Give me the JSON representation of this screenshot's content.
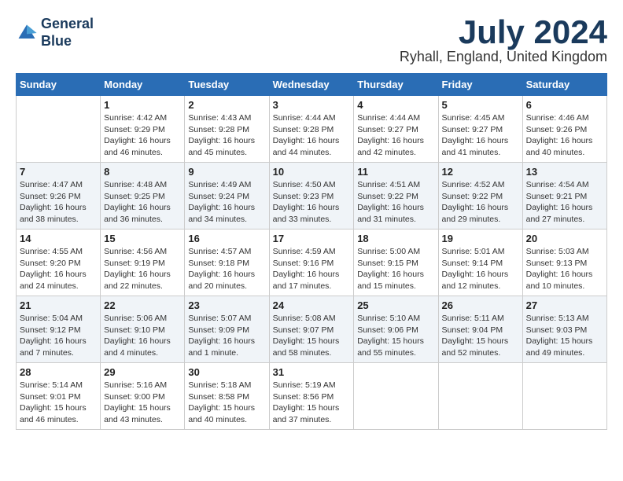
{
  "logo": {
    "line1": "General",
    "line2": "Blue"
  },
  "title": "July 2024",
  "location": "Ryhall, England, United Kingdom",
  "weekdays": [
    "Sunday",
    "Monday",
    "Tuesday",
    "Wednesday",
    "Thursday",
    "Friday",
    "Saturday"
  ],
  "weeks": [
    [
      {
        "day": "",
        "info": ""
      },
      {
        "day": "1",
        "info": "Sunrise: 4:42 AM\nSunset: 9:29 PM\nDaylight: 16 hours\nand 46 minutes."
      },
      {
        "day": "2",
        "info": "Sunrise: 4:43 AM\nSunset: 9:28 PM\nDaylight: 16 hours\nand 45 minutes."
      },
      {
        "day": "3",
        "info": "Sunrise: 4:44 AM\nSunset: 9:28 PM\nDaylight: 16 hours\nand 44 minutes."
      },
      {
        "day": "4",
        "info": "Sunrise: 4:44 AM\nSunset: 9:27 PM\nDaylight: 16 hours\nand 42 minutes."
      },
      {
        "day": "5",
        "info": "Sunrise: 4:45 AM\nSunset: 9:27 PM\nDaylight: 16 hours\nand 41 minutes."
      },
      {
        "day": "6",
        "info": "Sunrise: 4:46 AM\nSunset: 9:26 PM\nDaylight: 16 hours\nand 40 minutes."
      }
    ],
    [
      {
        "day": "7",
        "info": "Sunrise: 4:47 AM\nSunset: 9:26 PM\nDaylight: 16 hours\nand 38 minutes."
      },
      {
        "day": "8",
        "info": "Sunrise: 4:48 AM\nSunset: 9:25 PM\nDaylight: 16 hours\nand 36 minutes."
      },
      {
        "day": "9",
        "info": "Sunrise: 4:49 AM\nSunset: 9:24 PM\nDaylight: 16 hours\nand 34 minutes."
      },
      {
        "day": "10",
        "info": "Sunrise: 4:50 AM\nSunset: 9:23 PM\nDaylight: 16 hours\nand 33 minutes."
      },
      {
        "day": "11",
        "info": "Sunrise: 4:51 AM\nSunset: 9:22 PM\nDaylight: 16 hours\nand 31 minutes."
      },
      {
        "day": "12",
        "info": "Sunrise: 4:52 AM\nSunset: 9:22 PM\nDaylight: 16 hours\nand 29 minutes."
      },
      {
        "day": "13",
        "info": "Sunrise: 4:54 AM\nSunset: 9:21 PM\nDaylight: 16 hours\nand 27 minutes."
      }
    ],
    [
      {
        "day": "14",
        "info": "Sunrise: 4:55 AM\nSunset: 9:20 PM\nDaylight: 16 hours\nand 24 minutes."
      },
      {
        "day": "15",
        "info": "Sunrise: 4:56 AM\nSunset: 9:19 PM\nDaylight: 16 hours\nand 22 minutes."
      },
      {
        "day": "16",
        "info": "Sunrise: 4:57 AM\nSunset: 9:18 PM\nDaylight: 16 hours\nand 20 minutes."
      },
      {
        "day": "17",
        "info": "Sunrise: 4:59 AM\nSunset: 9:16 PM\nDaylight: 16 hours\nand 17 minutes."
      },
      {
        "day": "18",
        "info": "Sunrise: 5:00 AM\nSunset: 9:15 PM\nDaylight: 16 hours\nand 15 minutes."
      },
      {
        "day": "19",
        "info": "Sunrise: 5:01 AM\nSunset: 9:14 PM\nDaylight: 16 hours\nand 12 minutes."
      },
      {
        "day": "20",
        "info": "Sunrise: 5:03 AM\nSunset: 9:13 PM\nDaylight: 16 hours\nand 10 minutes."
      }
    ],
    [
      {
        "day": "21",
        "info": "Sunrise: 5:04 AM\nSunset: 9:12 PM\nDaylight: 16 hours\nand 7 minutes."
      },
      {
        "day": "22",
        "info": "Sunrise: 5:06 AM\nSunset: 9:10 PM\nDaylight: 16 hours\nand 4 minutes."
      },
      {
        "day": "23",
        "info": "Sunrise: 5:07 AM\nSunset: 9:09 PM\nDaylight: 16 hours\nand 1 minute."
      },
      {
        "day": "24",
        "info": "Sunrise: 5:08 AM\nSunset: 9:07 PM\nDaylight: 15 hours\nand 58 minutes."
      },
      {
        "day": "25",
        "info": "Sunrise: 5:10 AM\nSunset: 9:06 PM\nDaylight: 15 hours\nand 55 minutes."
      },
      {
        "day": "26",
        "info": "Sunrise: 5:11 AM\nSunset: 9:04 PM\nDaylight: 15 hours\nand 52 minutes."
      },
      {
        "day": "27",
        "info": "Sunrise: 5:13 AM\nSunset: 9:03 PM\nDaylight: 15 hours\nand 49 minutes."
      }
    ],
    [
      {
        "day": "28",
        "info": "Sunrise: 5:14 AM\nSunset: 9:01 PM\nDaylight: 15 hours\nand 46 minutes."
      },
      {
        "day": "29",
        "info": "Sunrise: 5:16 AM\nSunset: 9:00 PM\nDaylight: 15 hours\nand 43 minutes."
      },
      {
        "day": "30",
        "info": "Sunrise: 5:18 AM\nSunset: 8:58 PM\nDaylight: 15 hours\nand 40 minutes."
      },
      {
        "day": "31",
        "info": "Sunrise: 5:19 AM\nSunset: 8:56 PM\nDaylight: 15 hours\nand 37 minutes."
      },
      {
        "day": "",
        "info": ""
      },
      {
        "day": "",
        "info": ""
      },
      {
        "day": "",
        "info": ""
      }
    ]
  ]
}
